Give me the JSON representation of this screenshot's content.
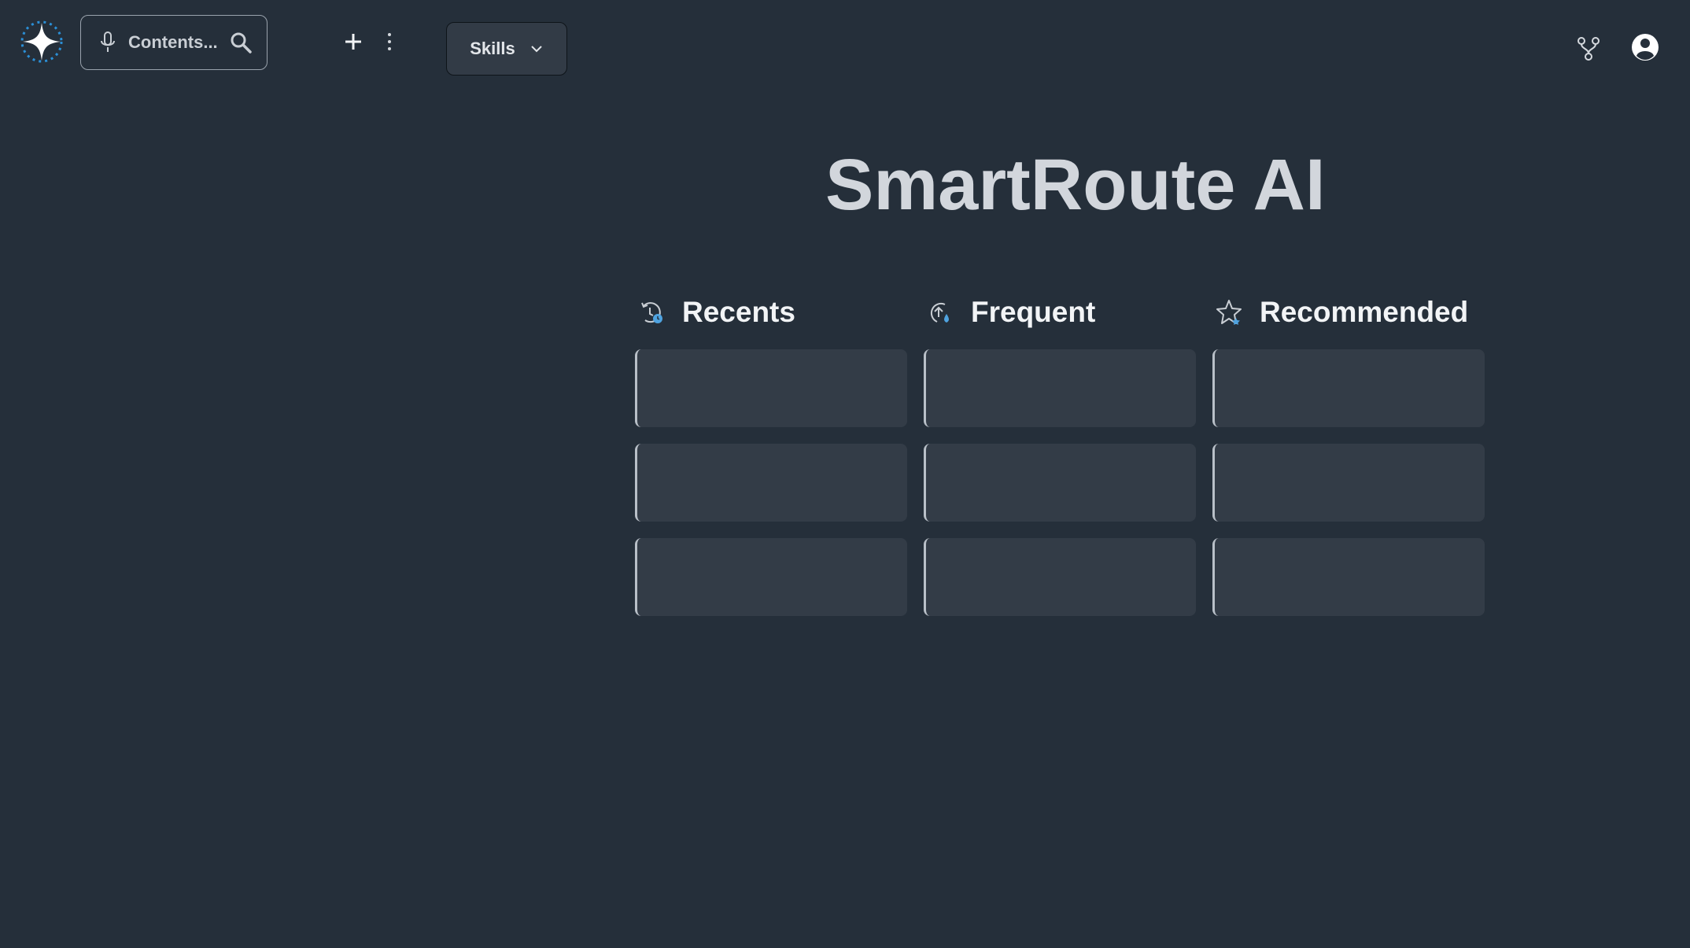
{
  "search": {
    "placeholder": "Contents..."
  },
  "toolbar": {
    "skills_label": "Skills"
  },
  "main": {
    "title": "SmartRoute AI",
    "columns": [
      {
        "label": "Recents",
        "icon": "recents-clock-icon",
        "cards": [
          "",
          "",
          ""
        ]
      },
      {
        "label": "Frequent",
        "icon": "frequent-upload-drop-icon",
        "cards": [
          "",
          "",
          ""
        ]
      },
      {
        "label": "Recommended",
        "icon": "recommended-star-icon",
        "cards": [
          "",
          "",
          ""
        ]
      }
    ]
  },
  "colors": {
    "background": "#252f3a",
    "card": "#333c47",
    "card_border": "#b9c0c8",
    "accent": "#4fa3e0",
    "text": "#d2d6dc"
  },
  "icons": {
    "logo": "sparkle-logo-icon",
    "mic": "microphone-icon",
    "search": "search-icon",
    "add": "plus-icon",
    "more": "more-vertical-icon",
    "caret": "chevron-down-icon",
    "branch": "branch-icon",
    "account": "account-circle-icon"
  }
}
